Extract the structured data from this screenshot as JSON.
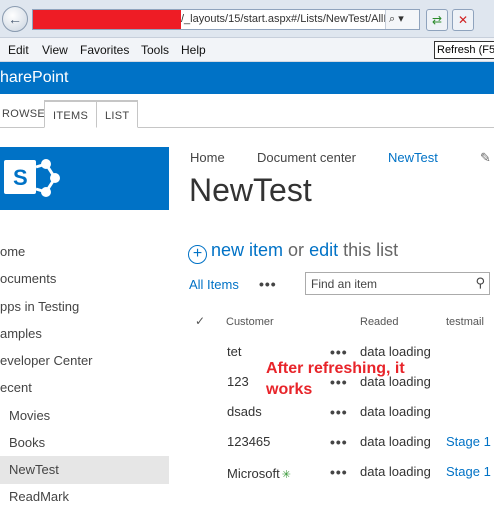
{
  "browser": {
    "url": "/_layouts/15/start.aspx#/Lists/NewTest/AllI",
    "search_glyph": "⌕ ▾",
    "back_glyph": "←",
    "refresh_glyph": "⇄",
    "stop_glyph": "✕",
    "tooltip": "Refresh (F5",
    "menu": [
      "Edit",
      "View",
      "Favorites",
      "Tools",
      "Help"
    ]
  },
  "suitebar": {
    "title": "harePoint"
  },
  "ribbon": {
    "tabs": [
      "ROWSE",
      "ITEMS",
      "LIST"
    ]
  },
  "logo": {
    "letter": "S"
  },
  "leftnav": [
    "ome",
    "ocuments",
    "pps in Testing",
    "amples",
    "eveloper Center",
    "ecent",
    "Movies",
    "Books",
    "NewTest",
    "ReadMark"
  ],
  "breadcrumb": {
    "home": "Home",
    "doc_center": "Document center",
    "current": "NewTest"
  },
  "page_title": "NewTest",
  "actions": {
    "new_item": "new item",
    "or": "or",
    "edit": "edit",
    "this_list": "this list"
  },
  "view": {
    "all_items": "All Items",
    "ellipsis": "•••",
    "find_placeholder": "Find an item"
  },
  "table": {
    "headers": {
      "check": "✓",
      "customer": "Customer",
      "readed": "Readed",
      "testmail": "testmail"
    },
    "rows": [
      {
        "customer": "tet",
        "readed": "data loading",
        "testmail": ""
      },
      {
        "customer": "123",
        "readed": "data loading",
        "testmail": ""
      },
      {
        "customer": "dsads",
        "readed": "data loading",
        "testmail": ""
      },
      {
        "customer": "123465",
        "readed": "data loading",
        "testmail": "Stage 1"
      },
      {
        "customer": "Microsoft",
        "readed": "data loading",
        "testmail": "Stage 1",
        "new_badge": "✳"
      }
    ]
  },
  "annotation": "After refreshing, it works",
  "colors": {
    "brand": "#0072c6",
    "annotation": "#e8242a",
    "redaction": "#ee1c25"
  }
}
